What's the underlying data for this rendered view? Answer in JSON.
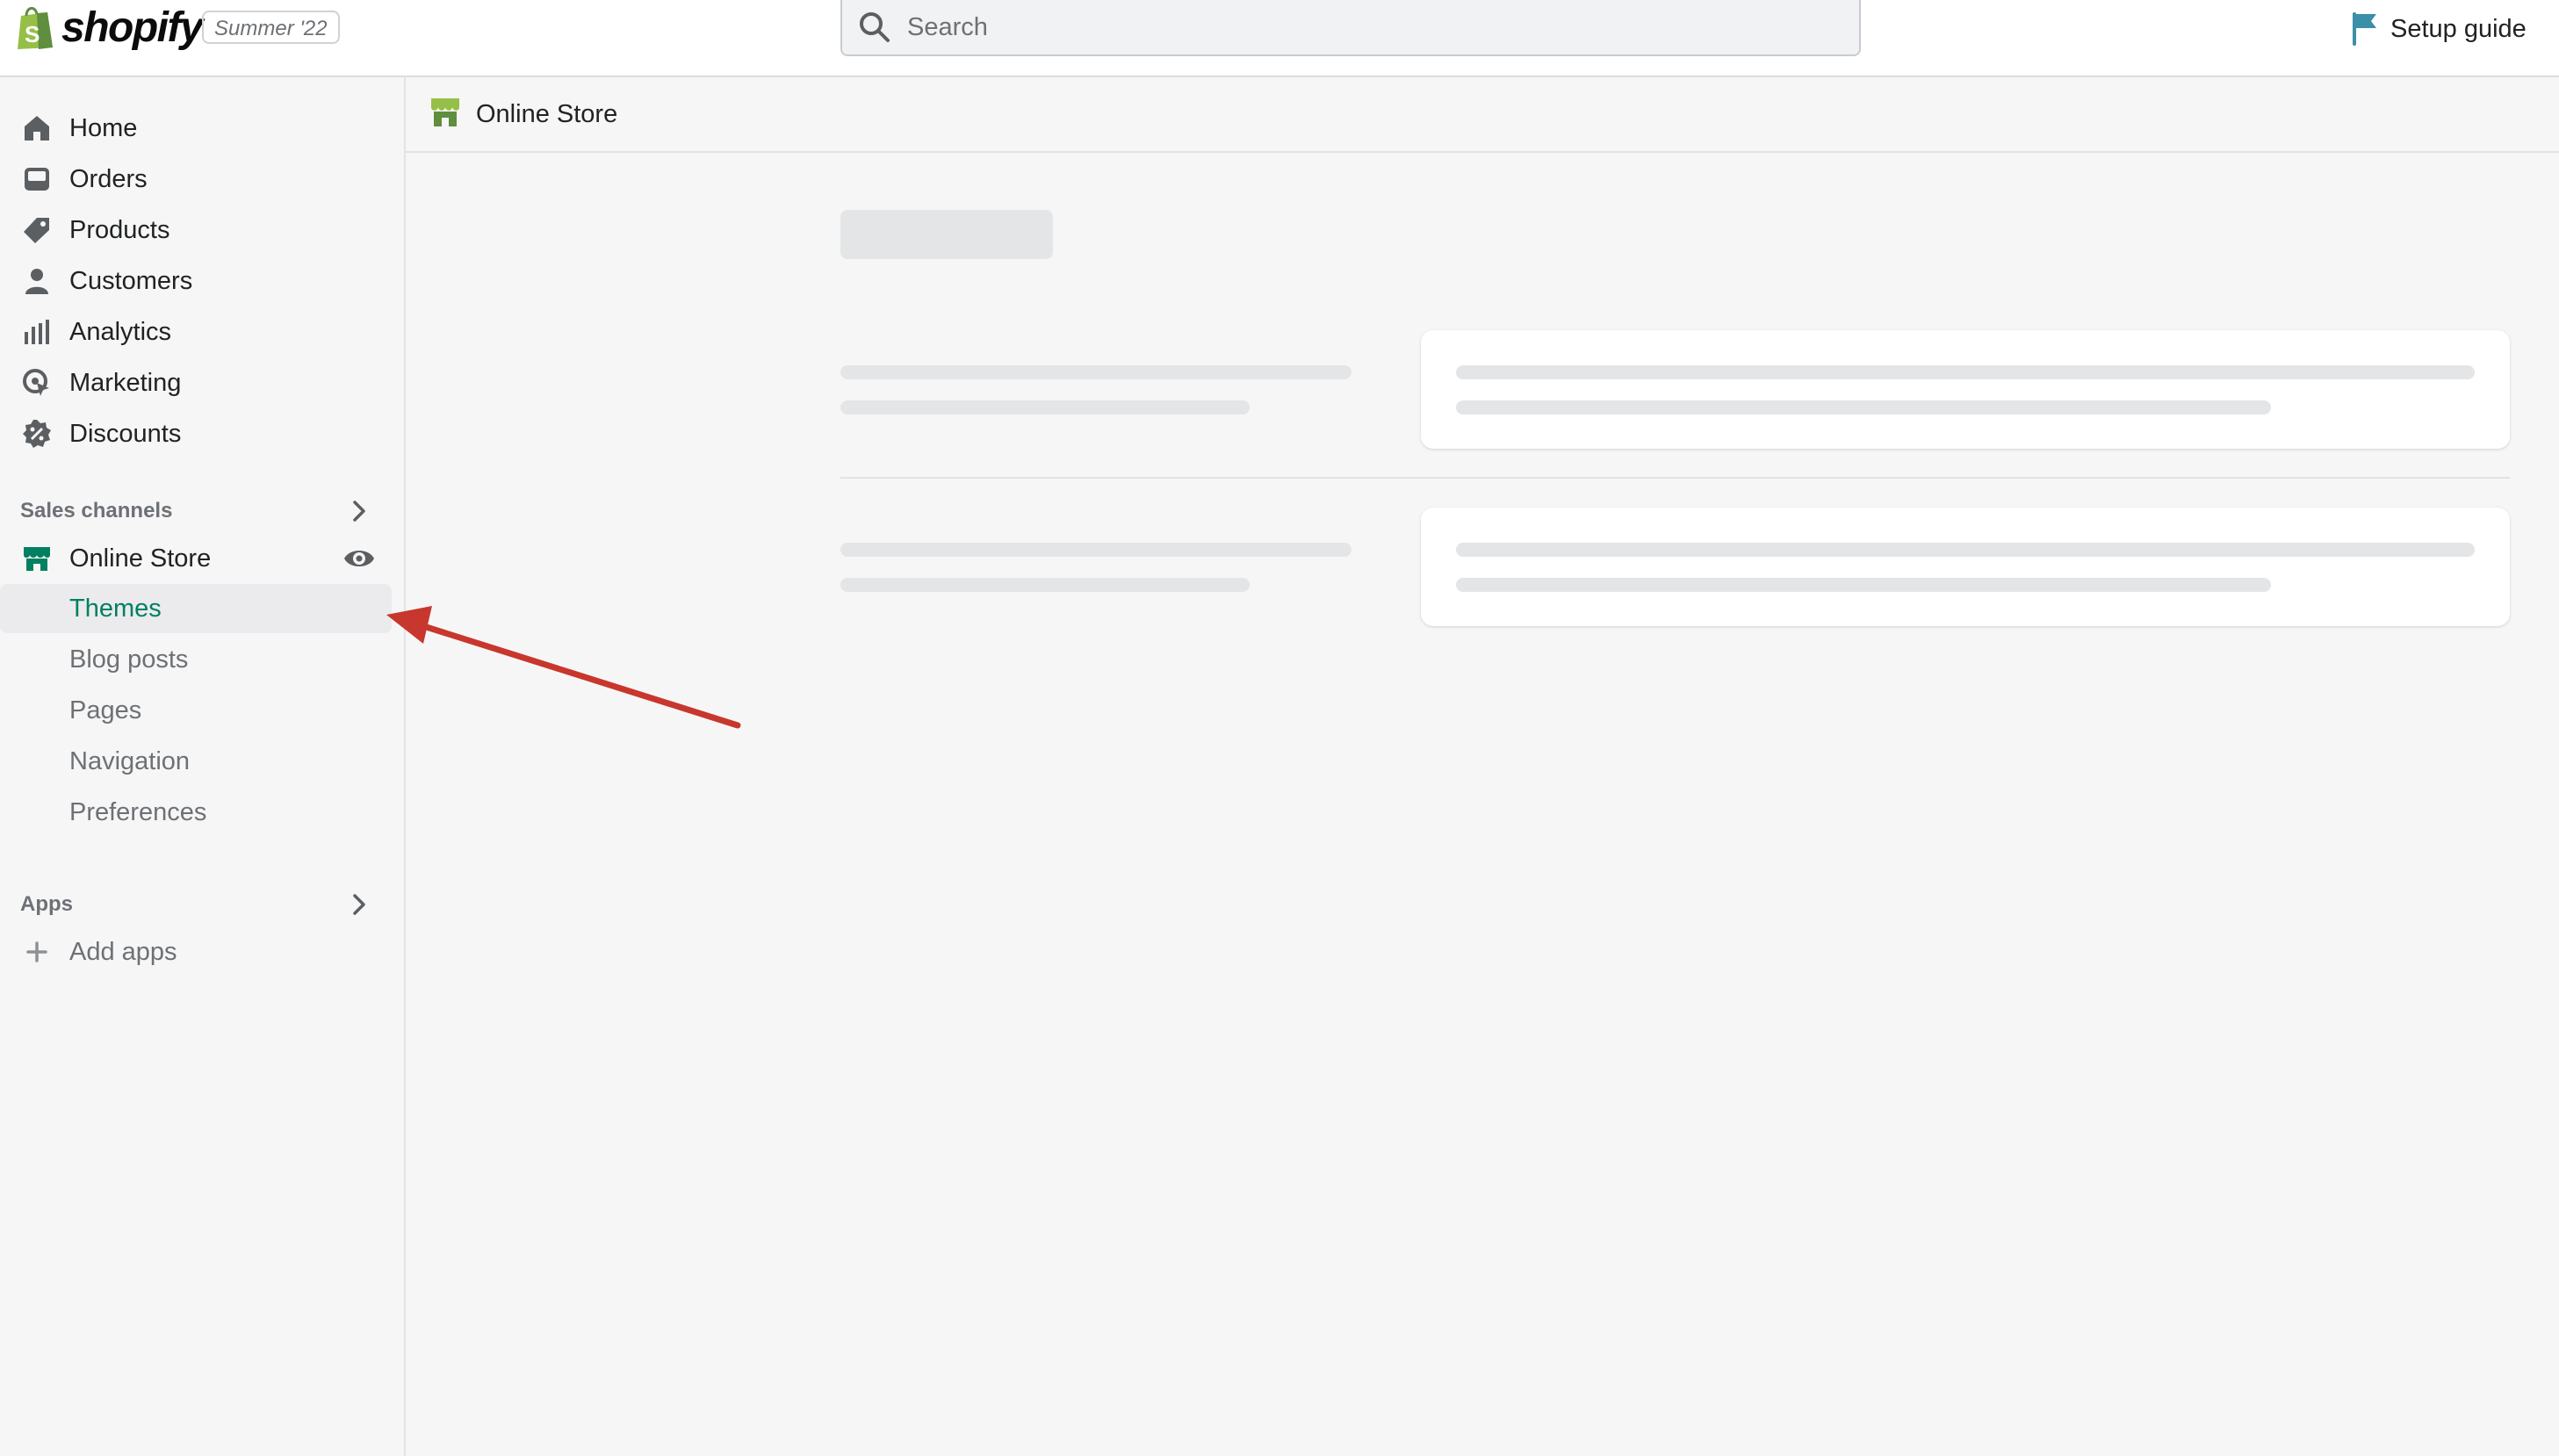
{
  "topbar": {
    "brand": "shopify",
    "edition": "Summer '22",
    "search_placeholder": "Search",
    "setup_guide": "Setup guide"
  },
  "sidebar": {
    "main_items": [
      {
        "label": "Home",
        "icon": "home-icon"
      },
      {
        "label": "Orders",
        "icon": "orders-icon"
      },
      {
        "label": "Products",
        "icon": "tag-icon"
      },
      {
        "label": "Customers",
        "icon": "person-icon"
      },
      {
        "label": "Analytics",
        "icon": "bar-chart-icon"
      },
      {
        "label": "Marketing",
        "icon": "target-icon"
      },
      {
        "label": "Discounts",
        "icon": "discount-icon"
      }
    ],
    "sales_channels_title": "Sales channels",
    "online_store": "Online Store",
    "sub_items": [
      "Themes",
      "Blog posts",
      "Pages",
      "Navigation",
      "Preferences"
    ],
    "active_sub_item": "Themes",
    "apps_title": "Apps",
    "add_apps": "Add apps"
  },
  "breadcrumb": {
    "title": "Online Store",
    "icon": "store-icon"
  },
  "colors": {
    "accent_green": "#008060",
    "annotation_arrow": "#c8372d",
    "setup_flag": "#3b8fa8"
  }
}
